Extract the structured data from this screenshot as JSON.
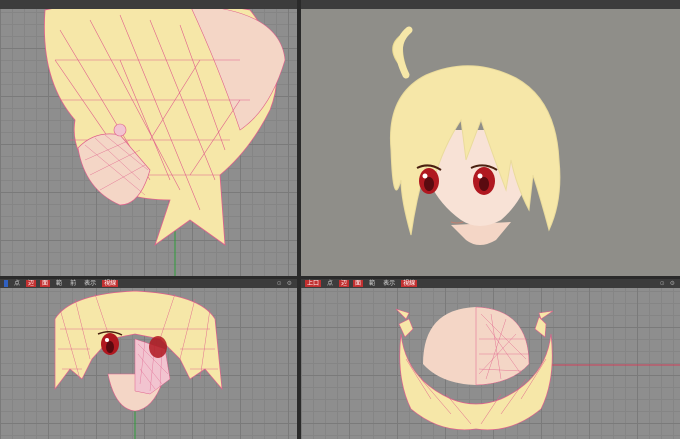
{
  "colors": {
    "viewport_grid": "#8e8e8e",
    "viewport_flat": "#8f8e89",
    "toolbar": "#3c3c3c",
    "hair": "#f6e7a8",
    "wire": "#e0608c",
    "skin": "#f4d6c6",
    "eye": "#b01820",
    "active_button": "#c23030"
  },
  "viewports": [
    {
      "id": "top-left",
      "toolbar": [
        "",
        "",
        "",
        ""
      ]
    },
    {
      "id": "top-right",
      "toolbar": [
        "",
        "",
        "",
        "",
        ""
      ]
    },
    {
      "id": "bottom-left",
      "toolbar": [
        "",
        "点",
        "辺",
        "面",
        "範",
        "前",
        "表示",
        "視線"
      ]
    },
    {
      "id": "bottom-right",
      "toolbar": [
        "上口",
        "点",
        "辺",
        "面",
        "範",
        "表示",
        "視線"
      ]
    }
  ]
}
